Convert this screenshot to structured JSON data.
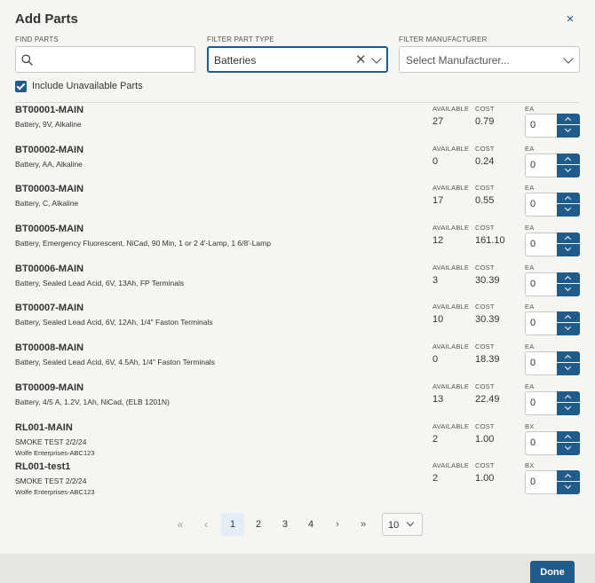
{
  "dialog": {
    "title": "Add Parts",
    "close_label": "×"
  },
  "filters": {
    "find_parts": {
      "label": "FIND PARTS",
      "value": "",
      "placeholder": ""
    },
    "part_type": {
      "label": "FILTER PART TYPE",
      "value": "Batteries"
    },
    "manufacturer": {
      "label": "FILTER MANUFACTURER",
      "placeholder": "Select Manufacturer..."
    }
  },
  "include_unavailable": {
    "label": "Include Unavailable Parts",
    "checked": true
  },
  "columns": {
    "available": "AVAILABLE",
    "cost": "COST"
  },
  "parts": [
    {
      "id": "BT00001-MAIN",
      "description": "Battery, 9V, Alkaline",
      "manufacturer": "",
      "available": "27",
      "cost": "0.79",
      "unit": "EA",
      "qty": "0"
    },
    {
      "id": "BT00002-MAIN",
      "description": "Battery, AA, Alkaline",
      "manufacturer": "",
      "available": "0",
      "cost": "0.24",
      "unit": "EA",
      "qty": "0"
    },
    {
      "id": "BT00003-MAIN",
      "description": "Battery, C, Alkaline",
      "manufacturer": "",
      "available": "17",
      "cost": "0.55",
      "unit": "EA",
      "qty": "0"
    },
    {
      "id": "BT00005-MAIN",
      "description": "Battery, Emergency Fluorescent, NiCad, 90 Min, 1 or 2 4'-Lamp, 1 6/8'-Lamp",
      "manufacturer": "",
      "available": "12",
      "cost": "161.10",
      "unit": "EA",
      "qty": "0"
    },
    {
      "id": "BT00006-MAIN",
      "description": "Battery, Sealed Lead Acid, 6V, 13Ah, FP Terminals",
      "manufacturer": "",
      "available": "3",
      "cost": "30.39",
      "unit": "EA",
      "qty": "0"
    },
    {
      "id": "BT00007-MAIN",
      "description": "Battery, Sealed Lead Acid, 6V, 12Ah, 1/4\" Faston Terminals",
      "manufacturer": "",
      "available": "10",
      "cost": "30.39",
      "unit": "EA",
      "qty": "0"
    },
    {
      "id": "BT00008-MAIN",
      "description": "Battery, Sealed Lead Acid, 6V, 4.5Ah, 1/4\" Faston Terminals",
      "manufacturer": "",
      "available": "0",
      "cost": "18.39",
      "unit": "EA",
      "qty": "0"
    },
    {
      "id": "BT00009-MAIN",
      "description": "Battery, 4/5 A, 1.2V, 1Ah, NiCad, (ELB 1201N)",
      "manufacturer": "",
      "available": "13",
      "cost": "22.49",
      "unit": "EA",
      "qty": "0"
    },
    {
      "id": "RL001-MAIN",
      "description": "SMOKE TEST 2/2/24",
      "manufacturer": "Wolfe Enterprises-ABC123",
      "available": "2",
      "cost": "1.00",
      "unit": "BX",
      "qty": "0"
    },
    {
      "id": "RL001-test1",
      "description": "SMOKE TEST 2/2/24",
      "manufacturer": "Wolfe Enterprises-ABC123",
      "available": "2",
      "cost": "1.00",
      "unit": "BX",
      "qty": "0"
    }
  ],
  "pagination": {
    "first": "«",
    "prev": "‹",
    "next": "›",
    "last": "»",
    "pages": [
      "1",
      "2",
      "3",
      "4"
    ],
    "current": "1",
    "page_size": "10"
  },
  "footer": {
    "done_label": "Done"
  },
  "colors": {
    "accent": "#1f5c8b"
  }
}
